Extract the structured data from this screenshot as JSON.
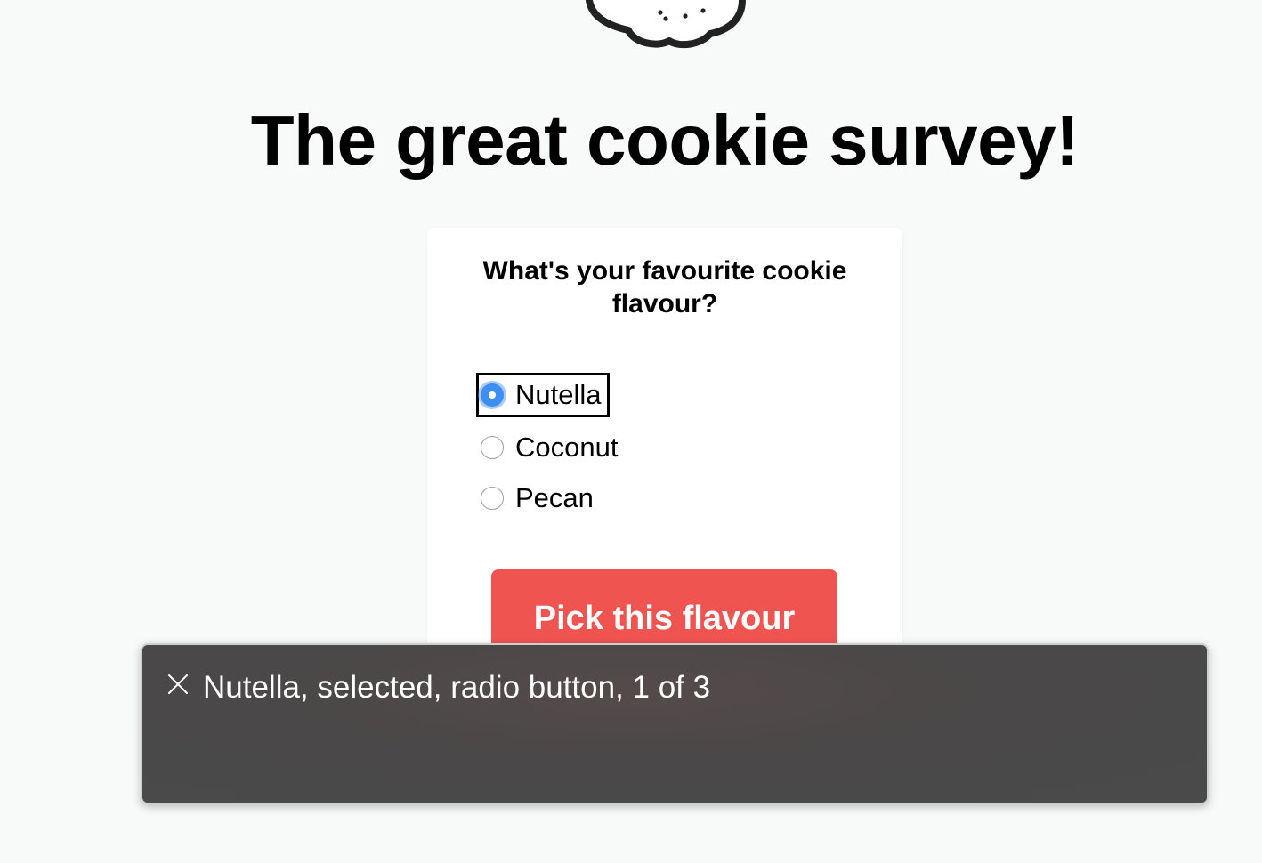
{
  "page": {
    "title": "The great cookie survey!",
    "logo_icon": "cookie-icon"
  },
  "survey": {
    "question": "What's your favourite cookie flavour?",
    "options": [
      {
        "label": "Nutella",
        "selected": true,
        "focused": true
      },
      {
        "label": "Coconut",
        "selected": false,
        "focused": false
      },
      {
        "label": "Pecan",
        "selected": false,
        "focused": false
      }
    ],
    "submit_label": "Pick this flavour"
  },
  "voiceover_caption": {
    "close_icon": "close-icon",
    "text": "Nutella, selected, radio button, 1 of 3"
  },
  "colors": {
    "button": "#f05450",
    "radio_selected": "#3d8ef3",
    "caption_background": "#4a4a4a"
  }
}
